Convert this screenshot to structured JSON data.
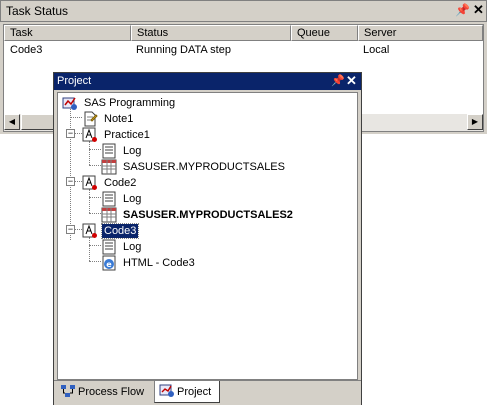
{
  "task_status": {
    "title": "Task Status",
    "pin_glyph": "ⱺ",
    "close_glyph": "✕",
    "columns": [
      "Task",
      "Status",
      "Queue",
      "Server"
    ],
    "rows": [
      {
        "task": "Code3",
        "status": "Running DATA step",
        "queue": "",
        "server": "Local"
      }
    ]
  },
  "project": {
    "title": "Project",
    "pin_glyph": "ⱺ",
    "close_glyph": "✕",
    "tree": {
      "root": "SAS Programming",
      "note": "Note1",
      "practice1": {
        "label": "Practice1",
        "log": "Log",
        "dataset": "SASUSER.MYPRODUCTSALES"
      },
      "code2": {
        "label": "Code2",
        "log": "Log",
        "dataset": "SASUSER.MYPRODUCTSALES2"
      },
      "code3": {
        "label": "Code3",
        "log": "Log",
        "html": "HTML - Code3"
      }
    },
    "tabs": [
      {
        "label": "Process Flow",
        "icon": "process-flow-icon",
        "active": false
      },
      {
        "label": "Project",
        "icon": "project-icon",
        "active": true
      }
    ]
  },
  "colors": {
    "chrome": "#d4d0c8",
    "title_active": "#0a246a",
    "selection": "#0a246a"
  }
}
